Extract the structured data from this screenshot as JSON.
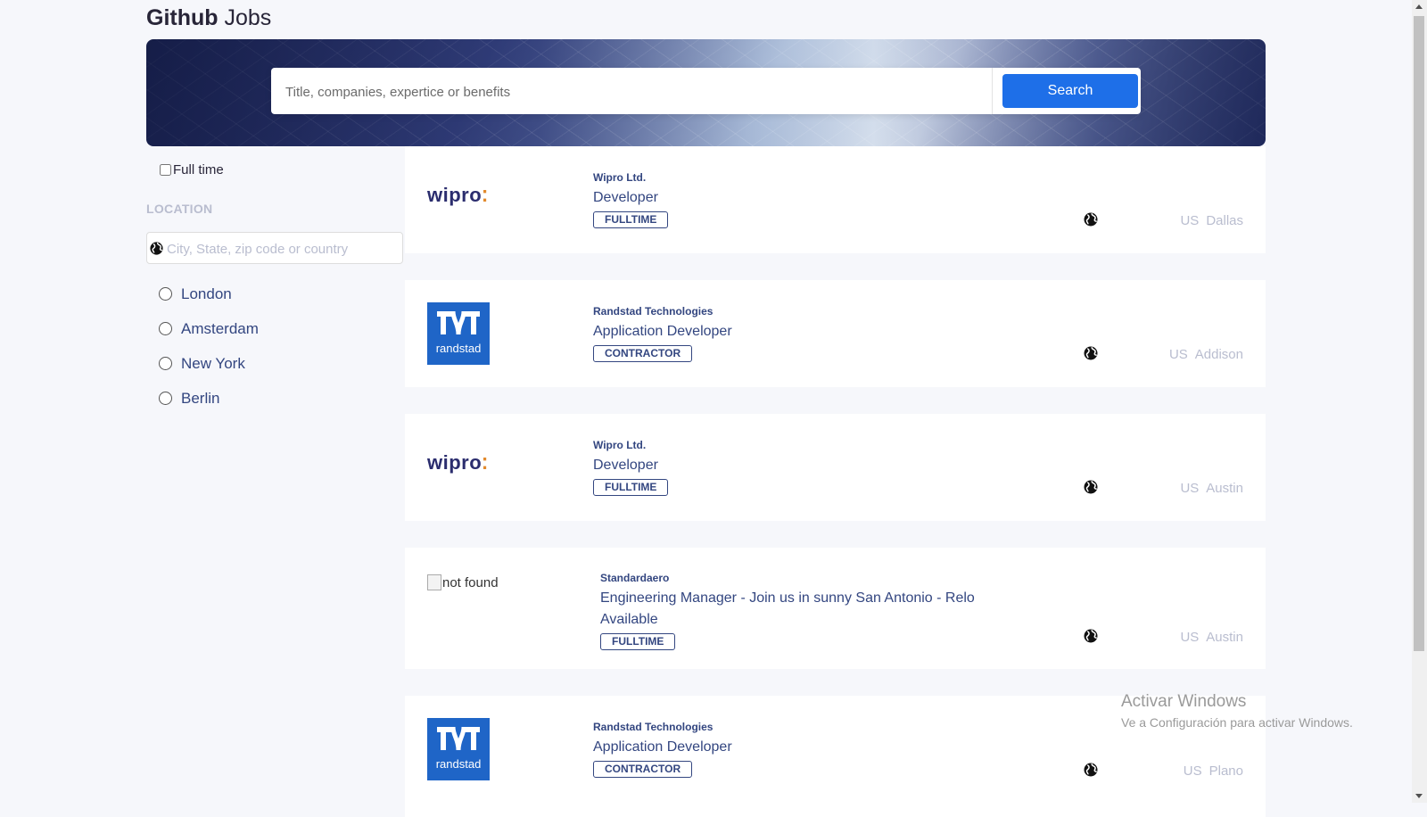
{
  "header": {
    "brand_bold": "Github",
    "brand_light": "Jobs"
  },
  "search": {
    "placeholder": "Title, companies, expertice or benefits",
    "button_label": "Search"
  },
  "sidebar": {
    "fulltime_label": "Full time",
    "location_heading": "LOCATION",
    "location_placeholder": "City, State, zip code or country",
    "cities": [
      "London",
      "Amsterdam",
      "New York",
      "Berlin"
    ]
  },
  "jobs": [
    {
      "company": "Wipro Ltd.",
      "title": "Developer",
      "type": "FULLTIME",
      "country": "US",
      "city": "Dallas",
      "logo": "wipro"
    },
    {
      "company": "Randstad Technologies",
      "title": "Application Developer",
      "type": "CONTRACTOR",
      "country": "US",
      "city": "Addison",
      "logo": "randstad"
    },
    {
      "company": "Wipro Ltd.",
      "title": "Developer",
      "type": "FULLTIME",
      "country": "US",
      "city": "Austin",
      "logo": "wipro"
    },
    {
      "company": "Standardaero",
      "title": "Engineering Manager - Join us in sunny San Antonio - Relo Available",
      "type": "FULLTIME",
      "country": "US",
      "city": "Austin",
      "logo": "broken",
      "logo_alt": "not found"
    },
    {
      "company": "Randstad Technologies",
      "title": "Application Developer",
      "type": "CONTRACTOR",
      "country": "US",
      "city": "Plano",
      "logo": "randstad"
    }
  ],
  "logos": {
    "wipro_text": "wipro",
    "randstad_text": "randstad"
  },
  "watermark": {
    "title": "Activar Windows",
    "subtitle": "Ve a Configuración para activar Windows."
  },
  "colors": {
    "accent": "#1e6fe8",
    "text": "#334680",
    "muted": "#b9bdcf",
    "randstad_blue": "#1f65c7"
  }
}
